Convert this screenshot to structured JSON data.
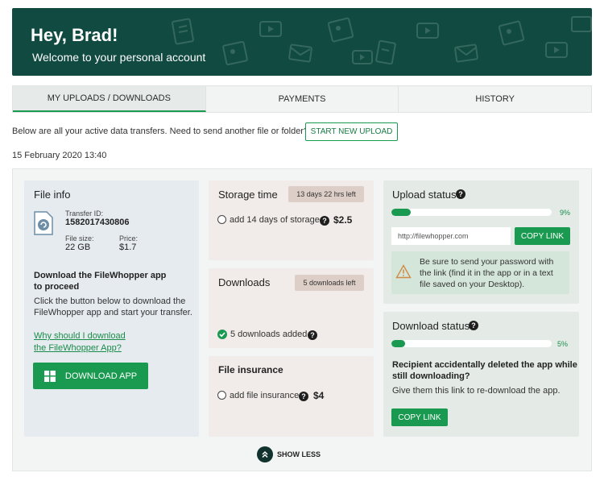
{
  "banner": {
    "greeting": "Hey, Brad!",
    "subtitle": "Welcome to your personal account"
  },
  "tabs": [
    {
      "label": "MY UPLOADS / DOWNLOADS",
      "active": true
    },
    {
      "label": "PAYMENTS",
      "active": false
    },
    {
      "label": "HISTORY",
      "active": false
    }
  ],
  "intro": {
    "text": "Below are all your active data transfers. Need to send another file or folder?",
    "button": "START NEW UPLOAD"
  },
  "date": "15 February 2020 13:40",
  "file_info": {
    "title": "File info",
    "transfer_id_label": "Transfer ID:",
    "transfer_id": "1582017430806",
    "file_size_label": "File size:",
    "file_size": "22 GB",
    "price_label": "Price:",
    "price": "$1.7",
    "download_heading_1": "Download the FileWhopper app",
    "download_heading_2": "to proceed",
    "download_text_1": "Click the button below to download the",
    "download_text_2": "FileWhopper app and start your transfer.",
    "why_link_1": "Why should I download",
    "why_link_2": "the FileWhopper App?",
    "download_button": "DOWNLOAD APP"
  },
  "storage": {
    "title": "Storage time",
    "badge": "13 days 22 hrs left",
    "option": "add 14 days of storage",
    "price": "$2.5"
  },
  "downloads": {
    "title": "Downloads",
    "badge": "5 downloads left",
    "added": "5 downloads added"
  },
  "insurance": {
    "title": "File insurance",
    "option": "add file insurance",
    "price": "$4"
  },
  "upload_status": {
    "title": "Upload status",
    "progress": 9,
    "progress_label": "9%",
    "url": "http://filewhopper.com",
    "copy_button": "COPY LINK",
    "warning_1": "Be sure to send your password with",
    "warning_2": "the link (find it in the app or in a text",
    "warning_3": "file saved on your Desktop)."
  },
  "download_status": {
    "title": "Download status",
    "progress": 5,
    "progress_label": "5%",
    "heading_1": "Recipient accidentally deleted the app while",
    "heading_2": "still downloading?",
    "text": "Give them this link to re-download the app.",
    "copy_button": "COPY LINK"
  },
  "show_less": "SHOW LESS",
  "colors": {
    "banner": "#114a41",
    "accent": "#1a9a50",
    "beige": "#f1ece9",
    "badge": "#ddcfc7"
  }
}
